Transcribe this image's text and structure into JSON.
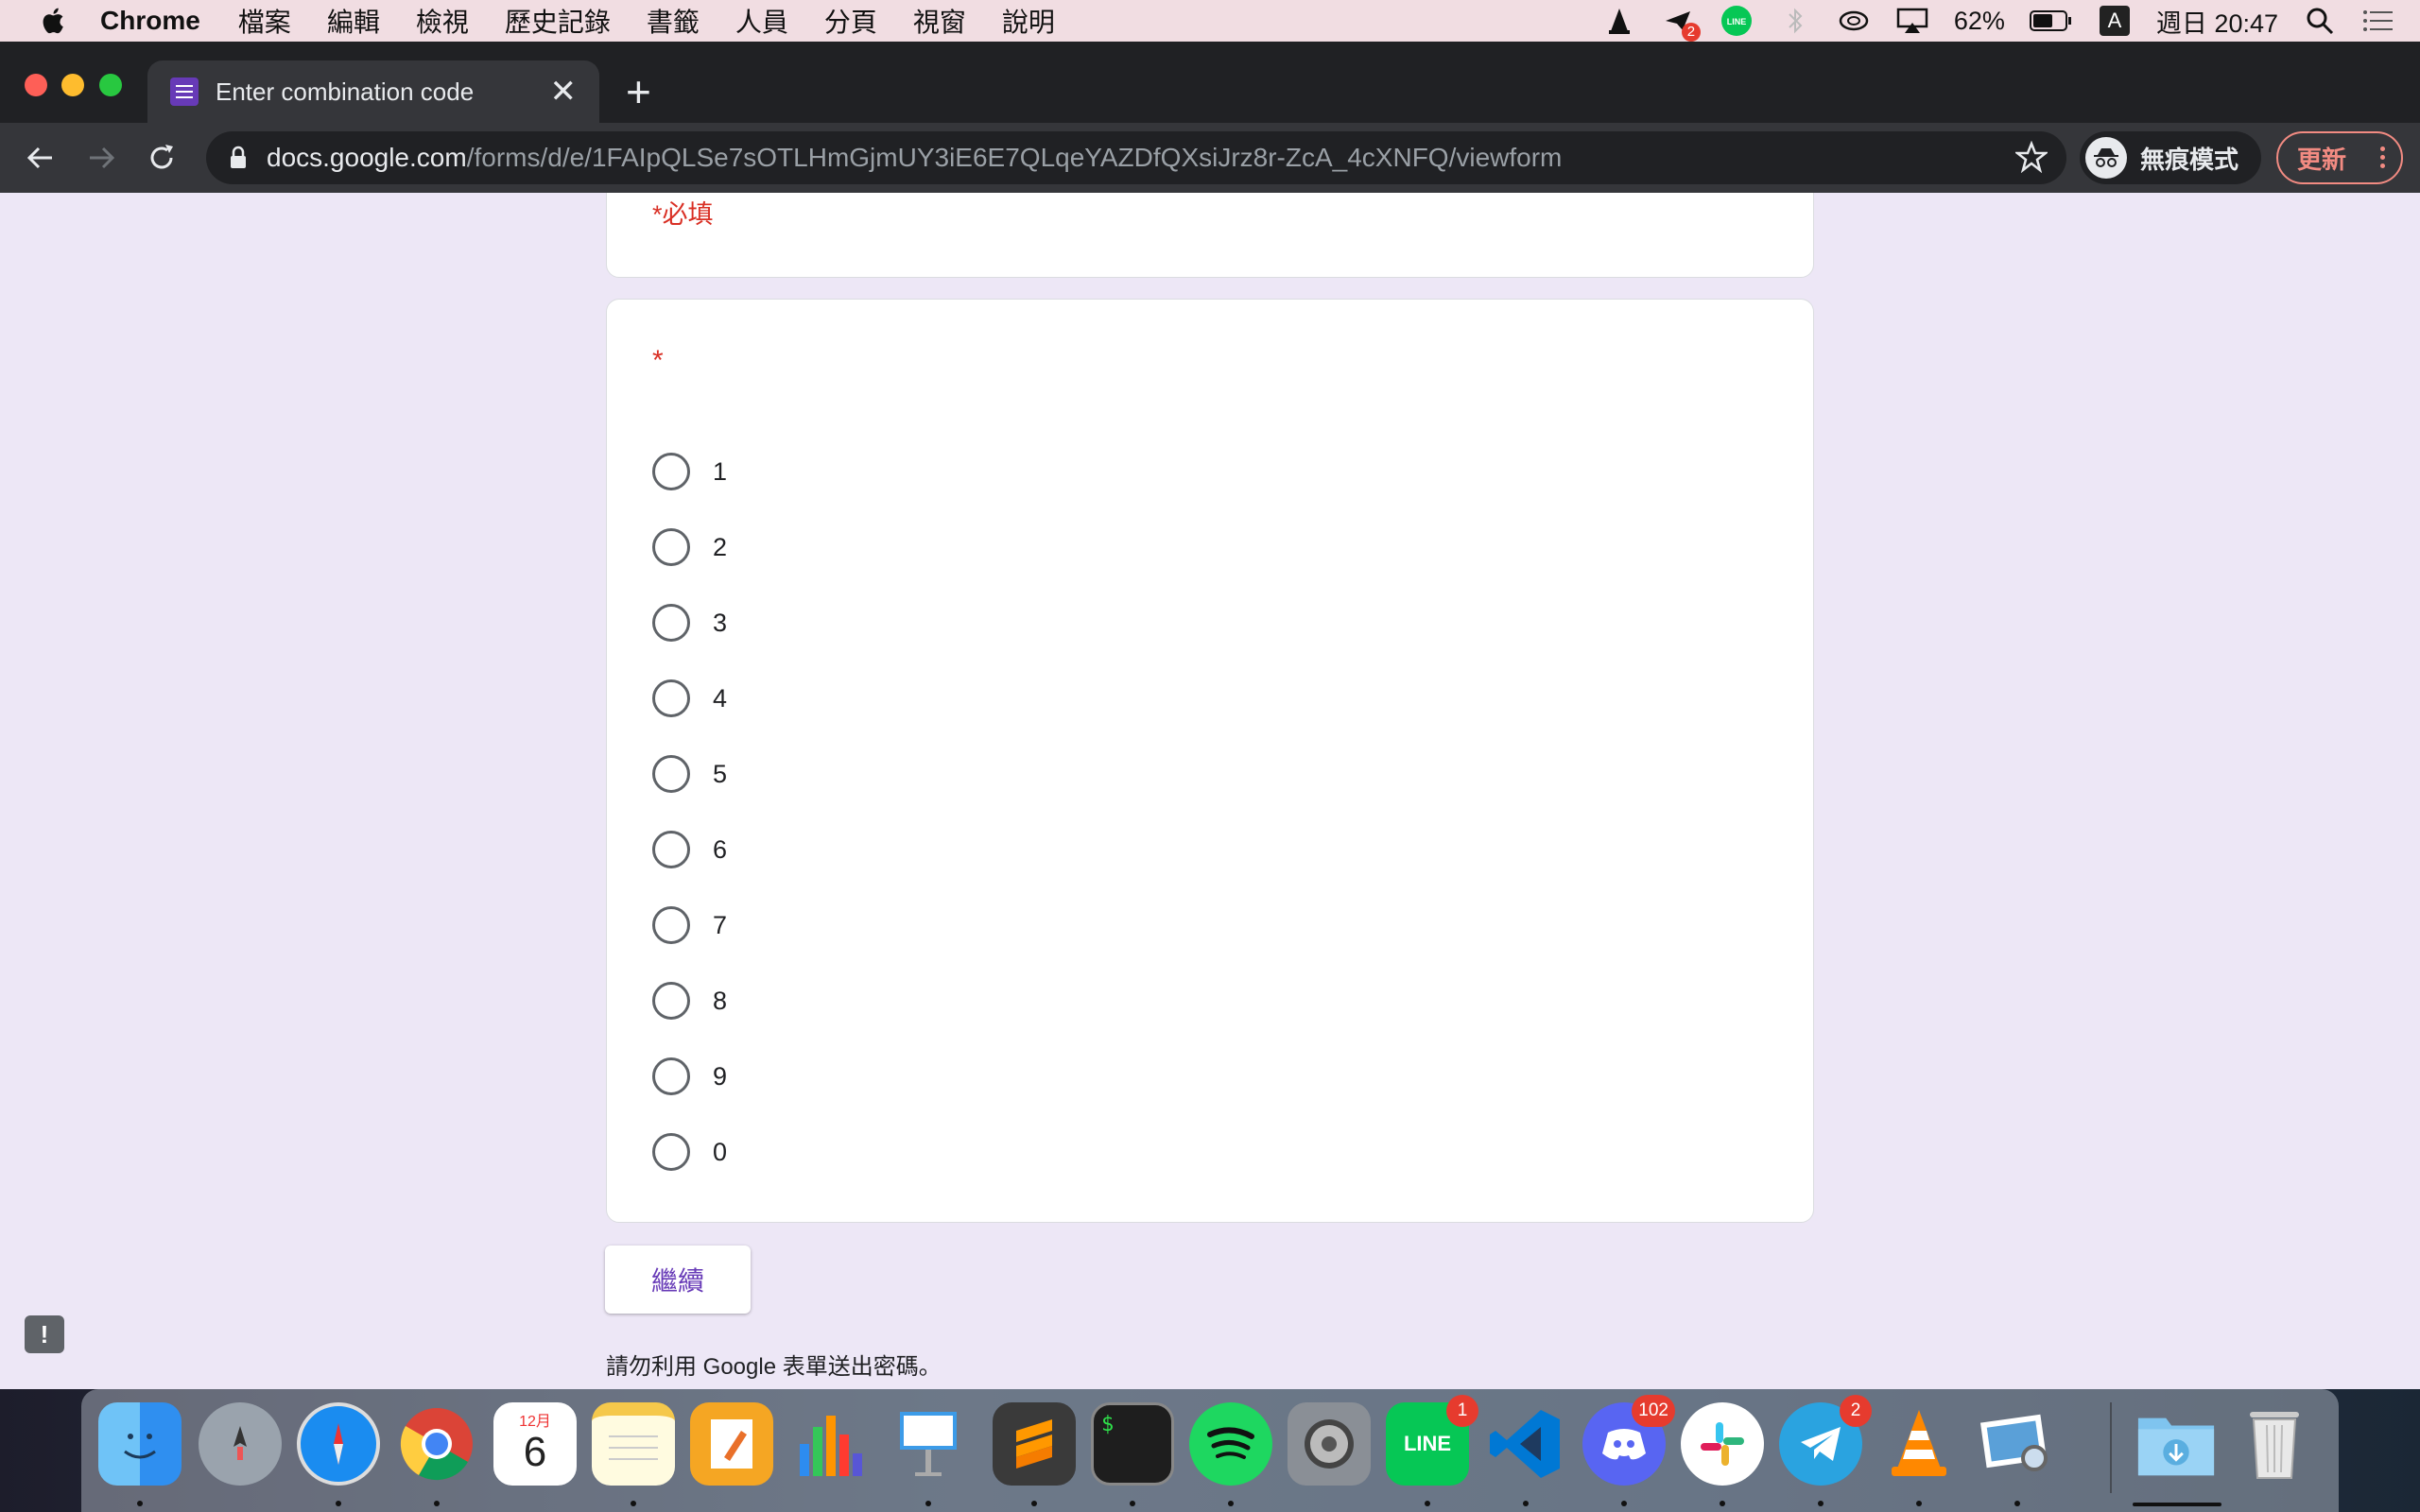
{
  "menubar": {
    "app_name": "Chrome",
    "items": [
      "檔案",
      "編輯",
      "檢視",
      "歷史記錄",
      "書籤",
      "人員",
      "分頁",
      "視窗",
      "說明"
    ],
    "battery": "62%",
    "input_source": "A",
    "clock": "週日 20:47",
    "notification_badge": "2"
  },
  "browser": {
    "tab_title": "Enter combination code",
    "url_host": "docs.google.com",
    "url_path": "/forms/d/e/1FAIpQLSe7sOTLHmGjmUY3iE6E7QLqeYAZDfQXsiJrz8r-ZcA_4cXNFQ/viewform",
    "incognito_label": "無痕模式",
    "update_label": "更新"
  },
  "form": {
    "required_note": "*必填",
    "question_marker": "*",
    "options": [
      "1",
      "2",
      "3",
      "4",
      "5",
      "6",
      "7",
      "8",
      "9",
      "0"
    ],
    "continue_label": "繼續",
    "footer_note": "請勿利用 Google 表單送出密碼。",
    "feedback_label": "!"
  },
  "dock": {
    "calendar_month": "12月",
    "calendar_day": "6",
    "terminal_prompt": "$",
    "line_text": "LINE",
    "line_badge": "1",
    "discord_badge": "102",
    "telegram_badge": "2"
  }
}
